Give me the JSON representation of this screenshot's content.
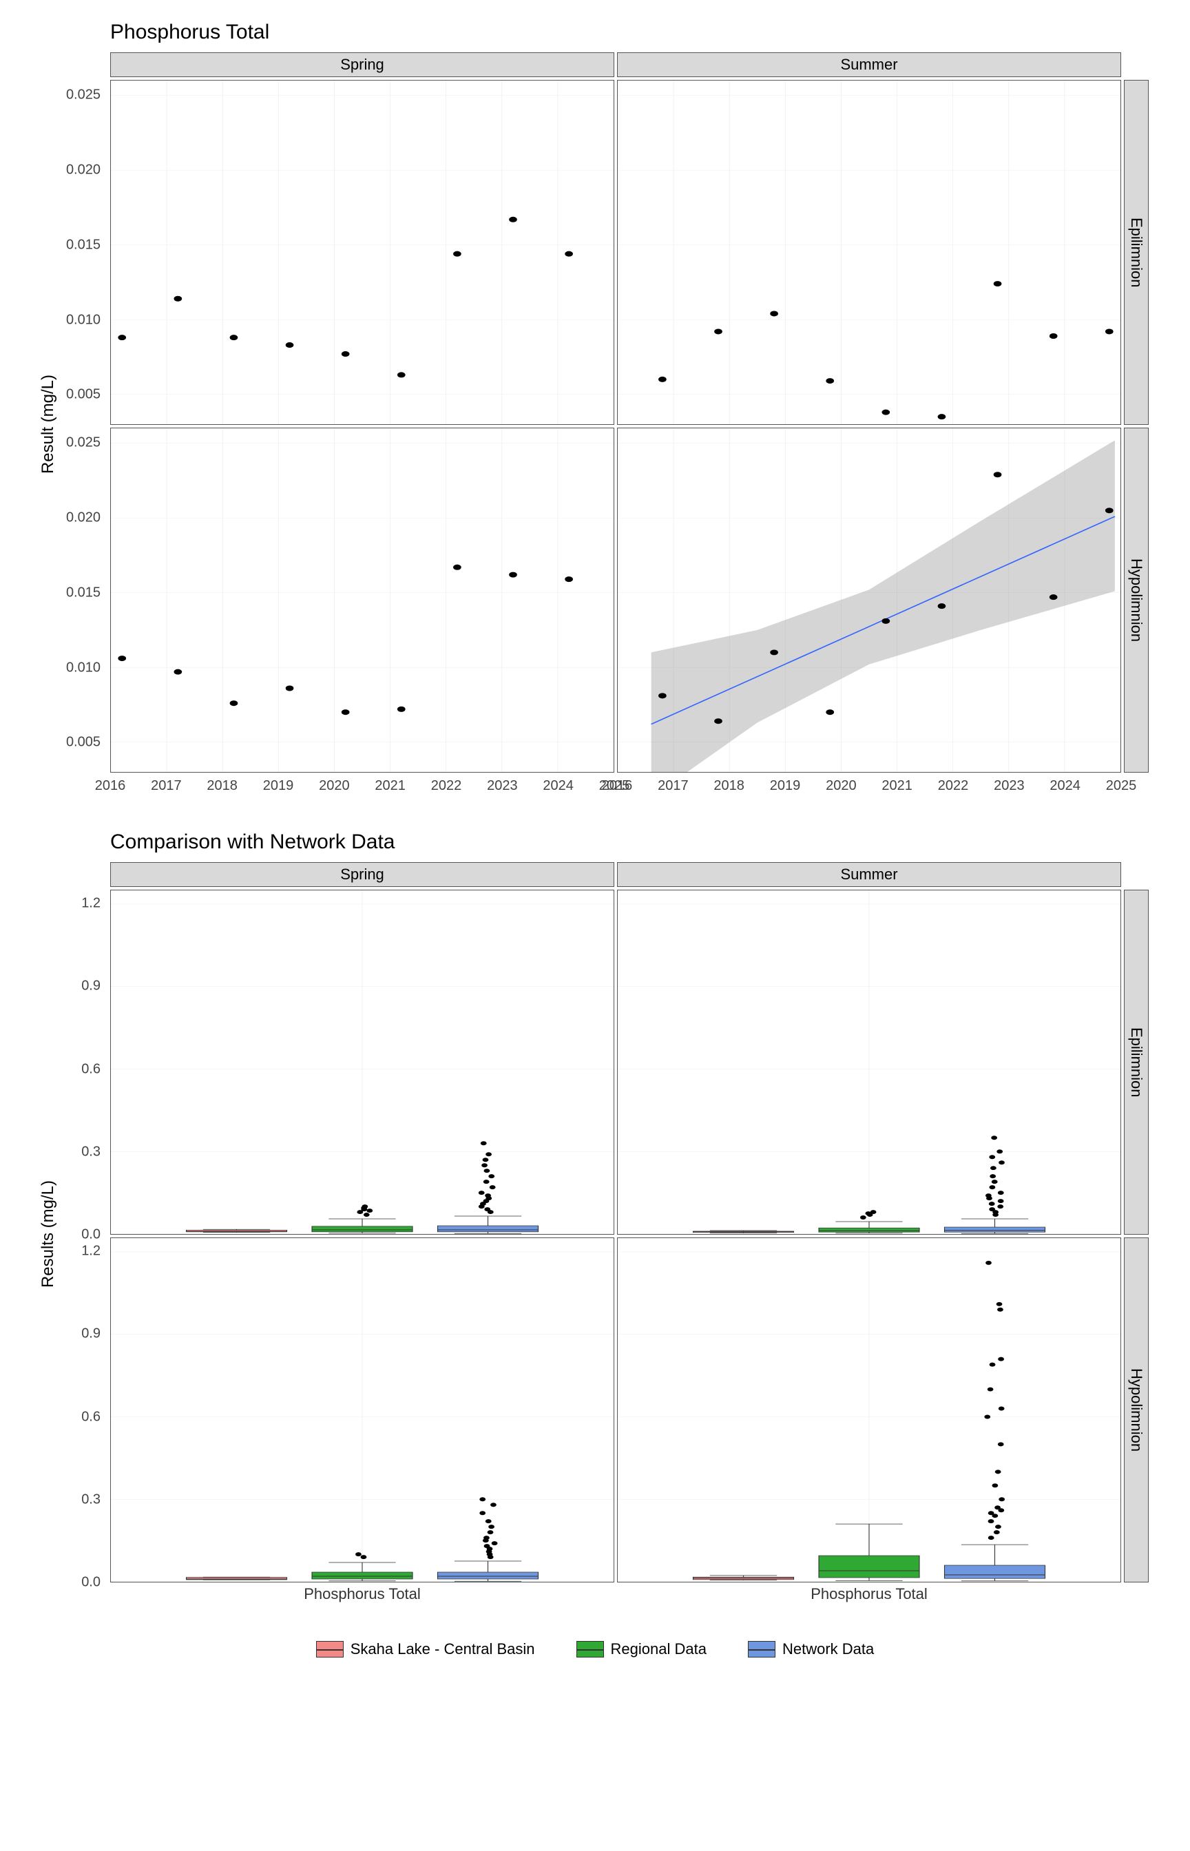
{
  "chart1": {
    "title": "Phosphorus Total",
    "ylabel": "Result (mg/L)",
    "col_facets": [
      "Spring",
      "Summer"
    ],
    "row_facets": [
      "Epilimnion",
      "Hypolimnion"
    ],
    "x_ticks": [
      "2016",
      "2017",
      "2018",
      "2019",
      "2020",
      "2021",
      "2022",
      "2023",
      "2024",
      "2025"
    ],
    "y_ticks": [
      "0.005",
      "0.010",
      "0.015",
      "0.020",
      "0.025"
    ]
  },
  "chart2": {
    "title": "Comparison with Network Data",
    "ylabel": "Results (mg/L)",
    "col_facets": [
      "Spring",
      "Summer"
    ],
    "row_facets": [
      "Epilimnion",
      "Hypolimnion"
    ],
    "x_cat": "Phosphorus Total",
    "y_ticks": [
      "0.0",
      "0.3",
      "0.6",
      "0.9",
      "1.2"
    ]
  },
  "legend": {
    "items": [
      {
        "label": "Skaha Lake - Central Basin",
        "color": "#f28a88"
      },
      {
        "label": "Regional Data",
        "color": "#2fa834"
      },
      {
        "label": "Network Data",
        "color": "#6f97e0"
      }
    ]
  },
  "chart_data": [
    {
      "type": "scatter",
      "title": "Phosphorus Total",
      "xlabel": "",
      "ylabel": "Result (mg/L)",
      "xlim": [
        2016,
        2025
      ],
      "ylim": [
        0.003,
        0.026
      ],
      "facets_col": [
        "Spring",
        "Summer"
      ],
      "facets_row": [
        "Epilimnion",
        "Hypolimnion"
      ],
      "panels": {
        "Spring|Epilimnion": {
          "x": [
            2016.2,
            2017.2,
            2018.2,
            2019.2,
            2020.2,
            2021.2,
            2022.2,
            2023.2,
            2024.2
          ],
          "y": [
            0.0088,
            0.0114,
            0.0088,
            0.0083,
            0.0077,
            0.0063,
            0.0144,
            0.0167,
            0.0144
          ]
        },
        "Summer|Epilimnion": {
          "x": [
            2016.8,
            2017.8,
            2018.8,
            2019.8,
            2020.8,
            2021.8,
            2022.8,
            2023.8,
            2024.8
          ],
          "y": [
            0.006,
            0.0092,
            0.0104,
            0.0059,
            0.0038,
            0.0035,
            0.0124,
            0.0089,
            0.0092
          ]
        },
        "Spring|Hypolimnion": {
          "x": [
            2016.2,
            2017.2,
            2018.2,
            2019.2,
            2020.2,
            2021.2,
            2022.2,
            2023.2,
            2024.2
          ],
          "y": [
            0.0106,
            0.0097,
            0.0076,
            0.0086,
            0.007,
            0.0072,
            0.0167,
            0.0162,
            0.0159
          ]
        },
        "Summer|Hypolimnion": {
          "x": [
            2016.8,
            2017.8,
            2018.8,
            2019.8,
            2020.8,
            2021.8,
            2022.8,
            2023.8,
            2024.8
          ],
          "y": [
            0.0081,
            0.0064,
            0.011,
            0.007,
            0.0131,
            0.0141,
            0.0229,
            0.0147,
            0.0205
          ],
          "trend": {
            "x0": 2016.6,
            "y0": 0.0062,
            "x1": 2024.9,
            "y1": 0.0201,
            "band": [
              {
                "x": 2016.6,
                "lo": 0.0013,
                "hi": 0.011
              },
              {
                "x": 2018.5,
                "lo": 0.0063,
                "hi": 0.0125
              },
              {
                "x": 2020.5,
                "lo": 0.0102,
                "hi": 0.0152
              },
              {
                "x": 2022.5,
                "lo": 0.0125,
                "hi": 0.0198
              },
              {
                "x": 2024.9,
                "lo": 0.0151,
                "hi": 0.0252
              }
            ]
          }
        }
      }
    },
    {
      "type": "boxplot",
      "title": "Comparison with Network Data",
      "xlabel": "Phosphorus Total",
      "ylabel": "Results (mg/L)",
      "ylim": [
        0,
        1.25
      ],
      "categories": [
        "Phosphorus Total"
      ],
      "series_order": [
        "Skaha Lake - Central Basin",
        "Regional Data",
        "Network Data"
      ],
      "colors": {
        "Skaha Lake - Central Basin": "#f28a88",
        "Regional Data": "#2fa834",
        "Network Data": "#6f97e0"
      },
      "panels": {
        "Spring|Epilimnion": {
          "boxes": [
            {
              "series": "Skaha Lake - Central Basin",
              "min": 0.006,
              "q1": 0.008,
              "median": 0.009,
              "q3": 0.014,
              "max": 0.017,
              "outliers": []
            },
            {
              "series": "Regional Data",
              "min": 0.003,
              "q1": 0.008,
              "median": 0.015,
              "q3": 0.028,
              "max": 0.055,
              "outliers": [
                0.07,
                0.08,
                0.085,
                0.09,
                0.095,
                0.1
              ]
            },
            {
              "series": "Network Data",
              "min": 0.002,
              "q1": 0.008,
              "median": 0.015,
              "q3": 0.03,
              "max": 0.065,
              "outliers": [
                0.08,
                0.09,
                0.1,
                0.11,
                0.12,
                0.13,
                0.14,
                0.15,
                0.17,
                0.19,
                0.21,
                0.23,
                0.25,
                0.27,
                0.29,
                0.33
              ]
            }
          ]
        },
        "Summer|Epilimnion": {
          "boxes": [
            {
              "series": "Skaha Lake - Central Basin",
              "min": 0.0035,
              "q1": 0.006,
              "median": 0.009,
              "q3": 0.01,
              "max": 0.0125,
              "outliers": []
            },
            {
              "series": "Regional Data",
              "min": 0.003,
              "q1": 0.007,
              "median": 0.012,
              "q3": 0.022,
              "max": 0.045,
              "outliers": [
                0.06,
                0.07,
                0.075,
                0.08
              ]
            },
            {
              "series": "Network Data",
              "min": 0.002,
              "q1": 0.007,
              "median": 0.013,
              "q3": 0.025,
              "max": 0.055,
              "outliers": [
                0.07,
                0.08,
                0.09,
                0.1,
                0.11,
                0.12,
                0.13,
                0.14,
                0.15,
                0.17,
                0.19,
                0.21,
                0.24,
                0.26,
                0.28,
                0.3,
                0.35
              ]
            }
          ]
        },
        "Spring|Hypolimnion": {
          "boxes": [
            {
              "series": "Skaha Lake - Central Basin",
              "min": 0.007,
              "q1": 0.0076,
              "median": 0.01,
              "q3": 0.016,
              "max": 0.017,
              "outliers": []
            },
            {
              "series": "Regional Data",
              "min": 0.003,
              "q1": 0.01,
              "median": 0.02,
              "q3": 0.035,
              "max": 0.07,
              "outliers": [
                0.09,
                0.1
              ]
            },
            {
              "series": "Network Data",
              "min": 0.002,
              "q1": 0.01,
              "median": 0.02,
              "q3": 0.035,
              "max": 0.075,
              "outliers": [
                0.09,
                0.1,
                0.11,
                0.12,
                0.13,
                0.14,
                0.15,
                0.16,
                0.18,
                0.2,
                0.22,
                0.25,
                0.28,
                0.3
              ]
            }
          ]
        },
        "Summer|Hypolimnion": {
          "boxes": [
            {
              "series": "Skaha Lake - Central Basin",
              "min": 0.006,
              "q1": 0.008,
              "median": 0.013,
              "q3": 0.017,
              "max": 0.023,
              "outliers": []
            },
            {
              "series": "Regional Data",
              "min": 0.004,
              "q1": 0.015,
              "median": 0.04,
              "q3": 0.095,
              "max": 0.21,
              "outliers": []
            },
            {
              "series": "Network Data",
              "min": 0.003,
              "q1": 0.012,
              "median": 0.025,
              "q3": 0.06,
              "max": 0.135,
              "outliers": [
                0.16,
                0.18,
                0.2,
                0.22,
                0.24,
                0.25,
                0.26,
                0.27,
                0.3,
                0.35,
                0.4,
                0.5,
                0.6,
                0.63,
                0.7,
                0.79,
                0.81,
                0.99,
                1.01,
                1.16
              ]
            }
          ]
        }
      }
    }
  ]
}
